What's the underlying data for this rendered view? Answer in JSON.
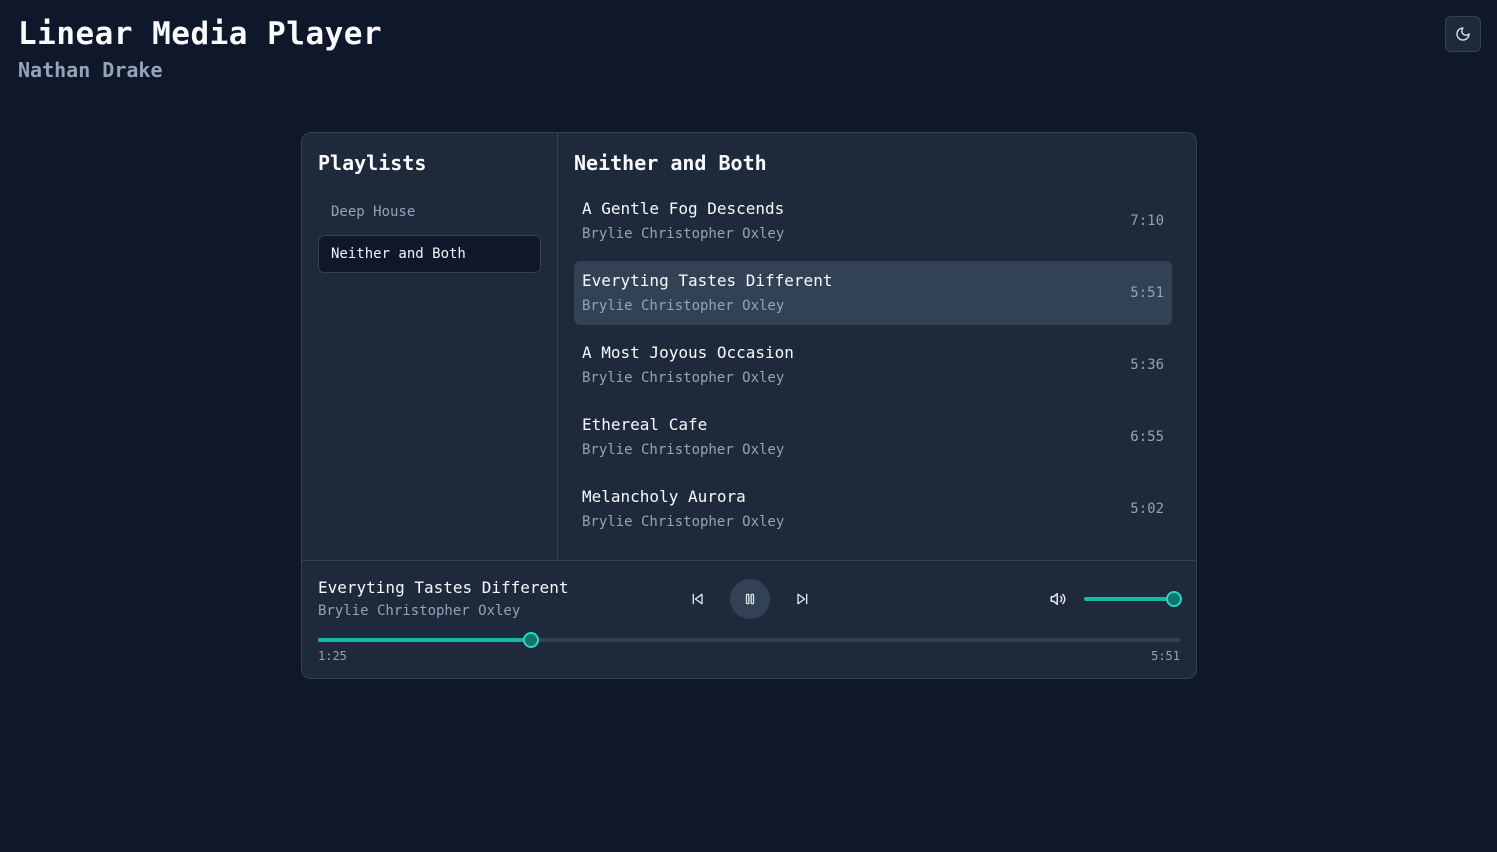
{
  "app": {
    "title": "Linear Media Player",
    "subtitle": "Nathan Drake",
    "theme_toggle_icon": "moon-icon"
  },
  "sidebar": {
    "title": "Playlists",
    "playlists": [
      {
        "label": "Deep House",
        "active": false
      },
      {
        "label": "Neither and Both",
        "active": true
      }
    ]
  },
  "tracklist": {
    "title": "Neither and Both",
    "tracks": [
      {
        "title": "A Gentle Fog Descends",
        "artist": "Brylie Christopher Oxley",
        "duration": "7:10",
        "active": false
      },
      {
        "title": "Everyting Tastes Different",
        "artist": "Brylie Christopher Oxley",
        "duration": "5:51",
        "active": true
      },
      {
        "title": "A Most Joyous Occasion",
        "artist": "Brylie Christopher Oxley",
        "duration": "5:36",
        "active": false
      },
      {
        "title": "Ethereal Cafe",
        "artist": "Brylie Christopher Oxley",
        "duration": "6:55",
        "active": false
      },
      {
        "title": "Melancholy Aurora",
        "artist": "Brylie Christopher Oxley",
        "duration": "5:02",
        "active": false
      }
    ]
  },
  "now_playing": {
    "title": "Everyting Tastes Different",
    "artist": "Brylie Christopher Oxley",
    "elapsed": "1:25",
    "total": "5:51",
    "progress_fraction": 0.247,
    "volume_fraction": 1.0,
    "is_playing": true
  },
  "icons": {
    "previous": "skip-back-icon",
    "play_pause": "pause-icon",
    "next": "skip-forward-icon",
    "volume": "volume-icon"
  },
  "colors": {
    "background": "#0f172a",
    "panel": "#1e293b",
    "border": "#334155",
    "accent": "#14b8a6",
    "muted_text": "#94a3b8"
  }
}
